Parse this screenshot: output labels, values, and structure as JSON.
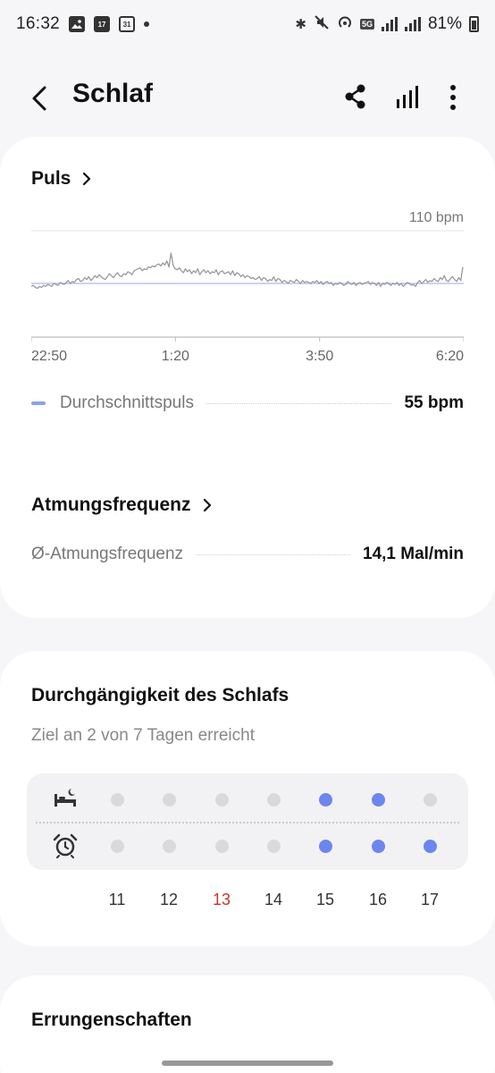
{
  "status_bar": {
    "time": "16:32",
    "notification_icons": [
      "gallery-icon",
      "calendar-17-icon",
      "calendar-31-icon",
      "dot-icon"
    ],
    "calendar_day_1": "17",
    "calendar_day_2": "31",
    "badge_5g": "5G",
    "battery": "81%"
  },
  "app_bar": {
    "title": "Schlaf"
  },
  "pulse": {
    "heading": "Puls",
    "y_max_label": "110 bpm",
    "x_labels": [
      "22:50",
      "1:20",
      "3:50",
      "6:20"
    ],
    "legend_label": "Durchschnittspuls",
    "legend_value": "55 bpm",
    "avg_line_color": "#c9d4f6",
    "line_color": "#9a9a9a"
  },
  "breathing": {
    "heading": "Atmungsfrequenz",
    "label": "Ø-Atmungsfrequenz",
    "value": "14,1 Mal/min"
  },
  "consistency": {
    "heading": "Durchgängigkeit des Schlafs",
    "subtitle": "Ziel an 2 von 7 Tagen erreicht",
    "days": [
      "11",
      "12",
      "13",
      "14",
      "15",
      "16",
      "17"
    ],
    "highlight_day_color": "#c0392b",
    "bedtime_met": [
      false,
      false,
      false,
      false,
      true,
      true,
      false
    ],
    "wake_met": [
      false,
      false,
      false,
      false,
      true,
      true,
      true
    ],
    "met_color": "#6d85ee",
    "unmet_color": "#d9d9d9"
  },
  "achievements": {
    "heading": "Errungenschaften"
  },
  "chart_data": {
    "type": "line",
    "title": "Puls",
    "x_ticks": [
      "22:50",
      "1:20",
      "3:50",
      "6:20"
    ],
    "y_label": "110 bpm",
    "ylim": [
      0,
      110
    ],
    "average": 55,
    "series": [
      {
        "values": [
          52,
          53,
          51,
          50,
          52,
          51,
          53,
          52,
          54,
          53,
          52,
          55,
          54,
          53,
          56,
          55,
          54,
          56,
          58,
          55,
          57,
          56,
          59,
          60,
          57,
          58,
          61,
          59,
          62,
          58,
          60,
          63,
          61,
          64,
          62,
          60,
          59,
          62,
          65,
          63,
          61,
          64,
          66,
          63,
          62,
          65,
          64,
          67,
          66,
          64,
          68,
          69,
          70,
          71,
          68,
          70,
          69,
          72,
          71,
          73,
          72,
          74,
          75,
          73,
          76,
          74,
          78,
          72,
          86,
          74,
          70,
          69,
          71,
          68,
          66,
          70,
          67,
          69,
          65,
          68,
          66,
          70,
          64,
          67,
          69,
          66,
          68,
          65,
          67,
          66,
          69,
          64,
          67,
          68,
          65,
          66,
          67,
          64,
          68,
          63,
          66,
          65,
          62,
          64,
          61,
          63,
          62,
          60,
          61,
          59,
          60,
          62,
          58,
          61,
          60,
          57,
          59,
          58,
          62,
          57,
          60,
          59,
          56,
          58,
          57,
          55,
          58,
          57,
          56,
          59,
          57,
          55,
          58,
          56,
          57,
          56,
          55,
          57,
          56,
          58,
          55,
          57,
          54,
          56,
          57,
          55,
          56,
          53,
          55,
          54,
          56,
          55,
          53,
          54,
          57,
          55,
          54,
          56,
          53,
          55,
          56,
          54,
          55,
          56,
          57,
          54,
          56,
          55,
          53,
          56,
          52,
          55,
          54,
          56,
          55,
          53,
          55,
          54,
          56,
          53,
          55,
          52,
          54,
          56,
          55,
          53,
          54,
          52,
          56,
          58,
          55,
          57,
          59,
          56,
          58,
          57,
          60,
          58,
          57,
          61,
          59,
          63,
          58,
          57,
          60,
          62,
          59,
          57,
          61,
          58,
          72
        ]
      }
    ]
  }
}
